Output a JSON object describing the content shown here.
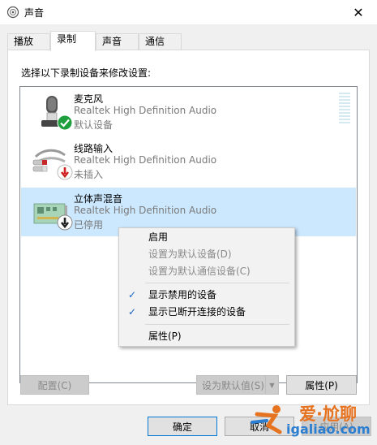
{
  "window": {
    "title": "声音",
    "close_glyph": "✕",
    "icon": "speaker-icon"
  },
  "tabs": [
    {
      "label": "播放",
      "active": false
    },
    {
      "label": "录制",
      "active": true
    },
    {
      "label": "声音",
      "active": false
    },
    {
      "label": "通信",
      "active": false
    }
  ],
  "instruction": "选择以下录制设备来修改设置:",
  "devices": [
    {
      "name": "麦克风",
      "driver": "Realtek High Definition Audio",
      "status": "默认设备",
      "icon": "microphone-icon",
      "badge": "default-check-icon",
      "selected": false
    },
    {
      "name": "线路输入",
      "driver": "Realtek High Definition Audio",
      "status": "未插入",
      "icon": "line-in-cable-icon",
      "badge": "unplugged-arrow-icon",
      "selected": false
    },
    {
      "name": "立体声混音",
      "driver": "Realtek High Definition Audio",
      "status": "已停用",
      "icon": "sound-card-icon",
      "badge": "disabled-arrow-icon",
      "selected": true
    }
  ],
  "context_menu": {
    "items": [
      {
        "label": "启用",
        "disabled": false,
        "checked": false
      },
      {
        "label": "设置为默认设备(D)",
        "disabled": true,
        "checked": false
      },
      {
        "label": "设置为默认通信设备(C)",
        "disabled": true,
        "checked": false
      },
      {
        "label": "显示禁用的设备",
        "disabled": false,
        "checked": true
      },
      {
        "label": "显示已断开连接的设备",
        "disabled": false,
        "checked": true
      },
      {
        "label": "属性(P)",
        "disabled": false,
        "checked": false
      }
    ],
    "check_glyph": "✓"
  },
  "buttons": {
    "configure": "配置(C)",
    "set_default": "设为默认值(S)",
    "set_default_arrow": "▼",
    "properties": "属性(P)",
    "ok": "确定",
    "cancel": "取消",
    "apply": "应用(A)"
  },
  "watermark": {
    "brand": "爱·尬聊",
    "url": "igaliao.com"
  },
  "colors": {
    "selection": "#cce8ff",
    "check_green": "#1e9e3c",
    "badge_red": "#d01f1f",
    "accent": "#0078d7"
  }
}
